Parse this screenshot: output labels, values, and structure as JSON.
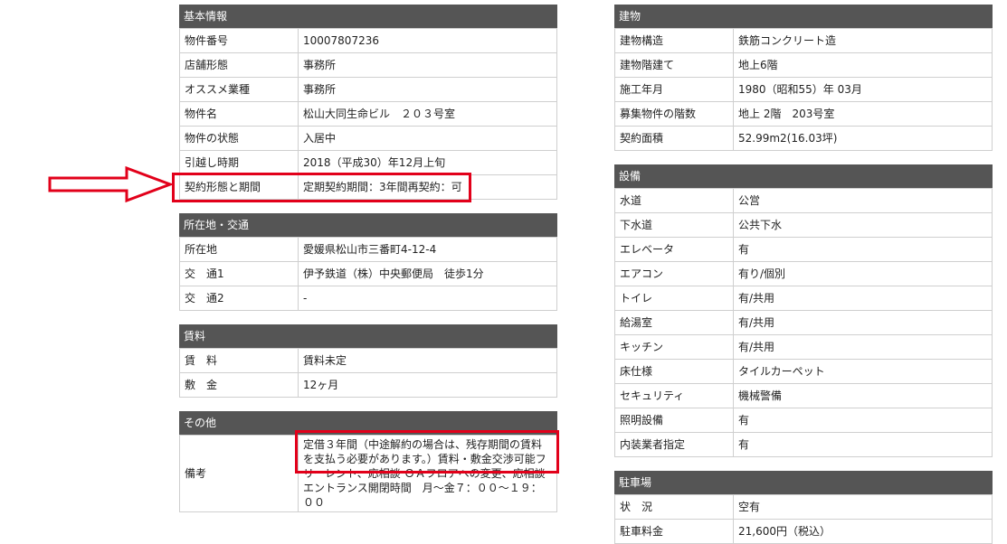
{
  "colors": {
    "header_bg": "#555555",
    "border": "#cfcfcf",
    "highlight": "#e2001a"
  },
  "sections": {
    "basic": {
      "title": "基本情報",
      "rows": [
        {
          "label": "物件番号",
          "value": "10007807236"
        },
        {
          "label": "店舗形態",
          "value": "事務所"
        },
        {
          "label": "オススメ業種",
          "value": "事務所"
        },
        {
          "label": "物件名",
          "value": "松山大同生命ビル　２０３号室"
        },
        {
          "label": "物件の状態",
          "value": "入居中"
        },
        {
          "label": "引越し時期",
          "value": "2018（平成30）年12月上旬"
        },
        {
          "label": "契約形態と期間",
          "value": "定期契約期間：3年間再契約：可"
        }
      ]
    },
    "location": {
      "title": "所在地・交通",
      "rows": [
        {
          "label": "所在地",
          "value": "愛媛県松山市三番町4-12-4"
        },
        {
          "label": "交　通1",
          "value": "伊予鉄道（株）中央郵便局　徒歩1分"
        },
        {
          "label": "交　通2",
          "value": "-"
        }
      ]
    },
    "rent": {
      "title": "賃料",
      "rows": [
        {
          "label": "賃　料",
          "value": "賃料未定"
        },
        {
          "label": "敷　金",
          "value": "12ヶ月"
        }
      ]
    },
    "other": {
      "title": "その他",
      "rows": [
        {
          "label": "備考",
          "value": "定借３年間（中途解約の場合は、残存期間の賃料を支払う必要があります。）賃料・敷金交渉可能フリーレント、応相談 ＯＡフロアへの変更、応相談 エントランス開閉時間　月～金７：００～１９：００"
        }
      ]
    },
    "building": {
      "title": "建物",
      "rows": [
        {
          "label": "建物構造",
          "value": "鉄筋コンクリート造"
        },
        {
          "label": "建物階建て",
          "value": "地上6階"
        },
        {
          "label": "施工年月",
          "value": "1980（昭和55）年 03月"
        },
        {
          "label": "募集物件の階数",
          "value": "地上 2階　203号室"
        },
        {
          "label": "契約面積",
          "value": "52.99m2(16.03坪)"
        }
      ]
    },
    "facilities": {
      "title": "設備",
      "rows": [
        {
          "label": "水道",
          "value": "公営"
        },
        {
          "label": "下水道",
          "value": "公共下水"
        },
        {
          "label": "エレベータ",
          "value": "有"
        },
        {
          "label": "エアコン",
          "value": "有り/個別"
        },
        {
          "label": "トイレ",
          "value": "有/共用"
        },
        {
          "label": "給湯室",
          "value": "有/共用"
        },
        {
          "label": "キッチン",
          "value": "有/共用"
        },
        {
          "label": "床仕様",
          "value": "タイルカーペット"
        },
        {
          "label": "セキュリティ",
          "value": "機械警備"
        },
        {
          "label": "照明設備",
          "value": "有"
        },
        {
          "label": "内装業者指定",
          "value": "有"
        }
      ]
    },
    "parking": {
      "title": "駐車場",
      "rows": [
        {
          "label": "状　況",
          "value": "空有"
        },
        {
          "label": "駐車料金",
          "value": "21,600円（税込）"
        }
      ]
    }
  }
}
